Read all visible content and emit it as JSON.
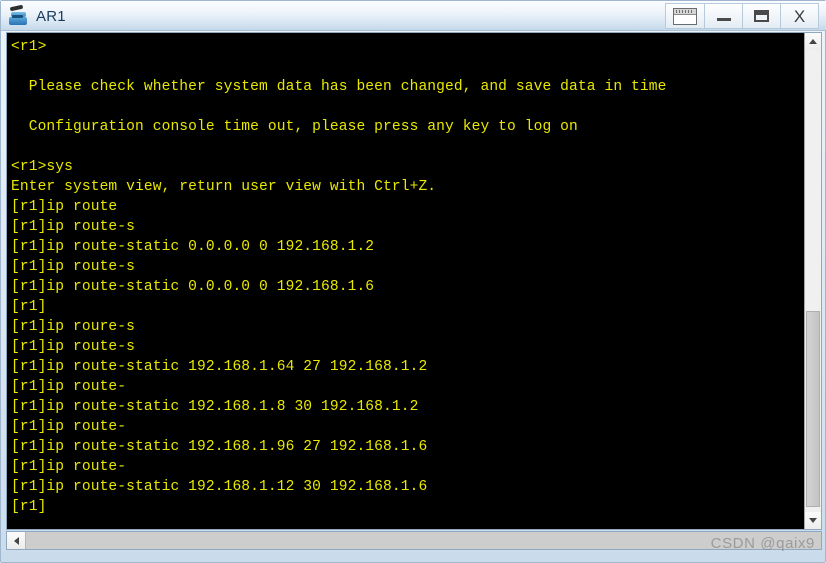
{
  "window": {
    "title": "AR1",
    "icon": "router-icon",
    "controls": [
      {
        "name": "restore-multi-window-button",
        "glyph": "multi-window-icon",
        "label": ""
      },
      {
        "name": "minimize-button",
        "glyph": "minimize-icon",
        "label": ""
      },
      {
        "name": "maximize-button",
        "glyph": "maximize-icon",
        "label": ""
      },
      {
        "name": "close-button",
        "glyph": "close-icon",
        "label": "X"
      }
    ]
  },
  "terminal": {
    "foreground_color": "#e8e800",
    "background_color": "#000000",
    "lines": [
      "<r1>",
      "",
      "  Please check whether system data has been changed, and save data in time",
      "",
      "  Configuration console time out, please press any key to log on",
      "",
      "<r1>sys",
      "Enter system view, return user view with Ctrl+Z.",
      "[r1]ip route",
      "[r1]ip route-s",
      "[r1]ip route-static 0.0.0.0 0 192.168.1.2",
      "[r1]ip route-s",
      "[r1]ip route-static 0.0.0.0 0 192.168.1.6",
      "[r1]",
      "[r1]ip roure-s",
      "[r1]ip route-s",
      "[r1]ip route-static 192.168.1.64 27 192.168.1.2",
      "[r1]ip route-",
      "[r1]ip route-static 192.168.1.8 30 192.168.1.2",
      "[r1]ip route-",
      "[r1]ip route-static 192.168.1.96 27 192.168.1.6",
      "[r1]ip route-",
      "[r1]ip route-static 192.168.1.12 30 192.168.1.6",
      "[r1]"
    ]
  },
  "scrollbars": {
    "vertical": {
      "up_arrow": "chevron-up-icon",
      "down_arrow": "chevron-down-icon"
    },
    "horizontal": {
      "left_arrow": "chevron-left-icon"
    }
  },
  "watermark": {
    "text": "CSDN @qaix9"
  }
}
